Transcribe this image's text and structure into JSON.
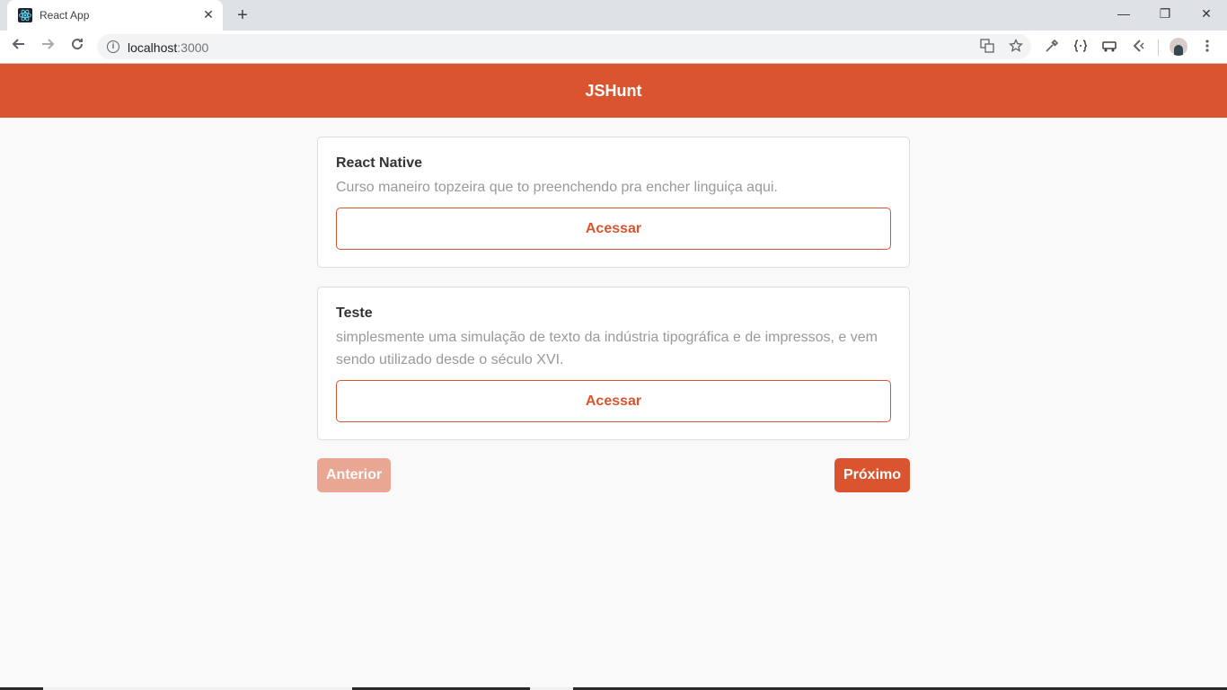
{
  "browser": {
    "tab_title": "React App",
    "tab_close": "✕",
    "new_tab": "+",
    "url_host": "localhost",
    "url_port": ":3000",
    "window_controls": {
      "minimize": "—",
      "restore": "❐",
      "close": "✕"
    },
    "icons": [
      "back-icon",
      "forward-icon",
      "reload-icon",
      "info-icon",
      "translate-icon",
      "star-icon",
      "eyedropper-icon",
      "braces-icon",
      "cast-icon",
      "extension-icon",
      "avatar",
      "menu-icon"
    ]
  },
  "app": {
    "header_title": "JSHunt",
    "accent_color": "#da552f",
    "products": [
      {
        "title": "React Native",
        "description": "Curso maneiro topzeira que to preenchendo pra encher linguiça aqui.",
        "button_label": "Acessar"
      },
      {
        "title": "Teste",
        "description": "simplesmente uma simulação de texto da indústria tipográfica e de impressos, e vem sendo utilizado desde o século XVI.",
        "button_label": "Acessar"
      }
    ],
    "pagination": {
      "prev_label": "Anterior",
      "prev_disabled": true,
      "next_label": "Próximo"
    }
  }
}
